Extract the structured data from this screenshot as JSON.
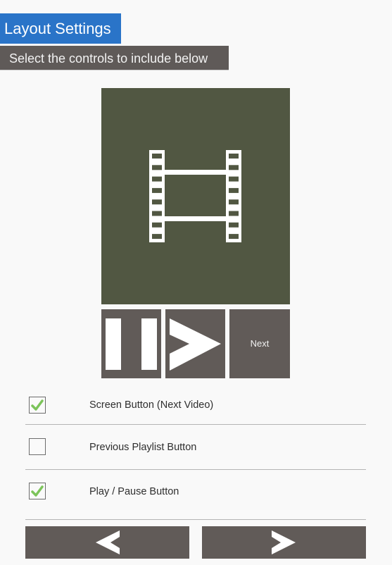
{
  "header": {
    "title": "Layout Settings",
    "subtitle": "Select the controls to include below"
  },
  "preview": {
    "icon": "film-strip-icon",
    "background_color": "#515742"
  },
  "controls": [
    {
      "name": "pause",
      "icon": "pause-icon"
    },
    {
      "name": "play",
      "icon": "play-icon"
    },
    {
      "name": "next",
      "label": "Next"
    }
  ],
  "options": [
    {
      "label": "Screen Button (Next Video)",
      "checked": true
    },
    {
      "label": "Previous Playlist Button",
      "checked": false
    },
    {
      "label": "Play / Pause Button",
      "checked": true
    }
  ],
  "navigation": {
    "back_icon": "chevron-left-icon",
    "forward_icon": "chevron-right-icon"
  },
  "colors": {
    "title_bg": "#2a74c8",
    "subtitle_bg": "#5f5a58",
    "button_bg": "#615b58",
    "check_green": "#7cc45a"
  }
}
